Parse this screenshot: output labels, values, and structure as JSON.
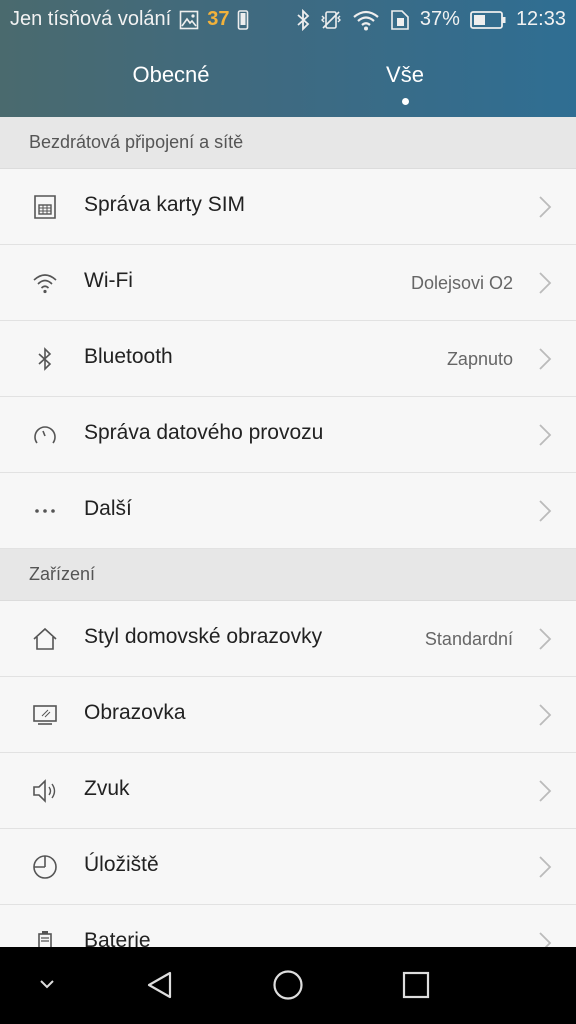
{
  "status_bar": {
    "carrier": "Jen tísňová volání",
    "notification_count": "37",
    "battery_percent": "37%",
    "time": "12:33"
  },
  "tabs": {
    "general": "Obecné",
    "all": "Vše",
    "selected": "Vše"
  },
  "sections": {
    "wireless": {
      "title": "Bezdrátová připojení a sítě",
      "items": [
        {
          "label": "Správa karty SIM",
          "value": "",
          "icon": "sim-card-icon"
        },
        {
          "label": "Wi-Fi",
          "value": "Dolejsovi O2",
          "icon": "wifi-icon"
        },
        {
          "label": "Bluetooth",
          "value": "Zapnuto",
          "icon": "bluetooth-icon"
        },
        {
          "label": "Správa datového provozu",
          "value": "",
          "icon": "data-usage-icon"
        },
        {
          "label": "Další",
          "value": "",
          "icon": "more-icon"
        }
      ]
    },
    "device": {
      "title": "Zařízení",
      "items": [
        {
          "label": "Styl domovské obrazovky",
          "value": "Standardní",
          "icon": "home-icon"
        },
        {
          "label": "Obrazovka",
          "value": "",
          "icon": "display-icon"
        },
        {
          "label": "Zvuk",
          "value": "",
          "icon": "speaker-icon"
        },
        {
          "label": "Úložiště",
          "value": "",
          "icon": "storage-icon"
        },
        {
          "label": "Baterie",
          "value": "",
          "icon": "battery-icon"
        }
      ]
    }
  },
  "colors": {
    "header_start": "#4a6a6e",
    "header_end": "#2f6e93",
    "notification_accent": "#f2b23b"
  }
}
